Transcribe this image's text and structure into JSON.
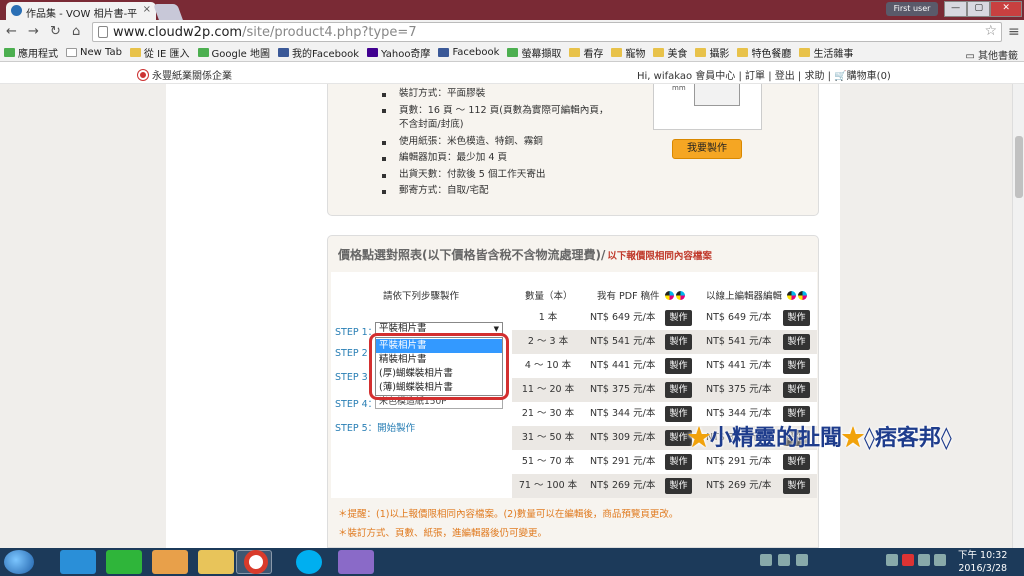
{
  "browser": {
    "tab_title": "作品集 - VOW 相片書-平",
    "tab_close": "×",
    "user_badge": "First user",
    "window_buttons": [
      "—",
      "▢",
      "✕"
    ],
    "nav_icons": [
      "back-arrow-icon",
      "forward-arrow-icon",
      "reload-icon",
      "home-icon"
    ],
    "url_domain": "www.cloudw2p.com",
    "url_path": "/site/product4.php?type=7",
    "bookmarks": [
      "應用程式",
      "New Tab",
      "從 IE 匯入",
      "Google 地圖",
      "我的Facebook",
      "Yahoo奇摩",
      "Facebook",
      "螢幕擷取",
      "看存",
      "寵物",
      "美食",
      "攝影",
      "特色餐廳",
      "生活雜事"
    ],
    "other_bookmarks": "其他書籤"
  },
  "site": {
    "company": "永豐紙業關係企業",
    "user_links": "Hi, wifakao 會員中心 | 訂單 | 登出 | 求助 |",
    "cart": "購物車(0)"
  },
  "specs": [
    "裝訂方式：平面膠裝",
    "頁數：16 頁 ～ 112 頁(頁數為實際可編輯內頁，",
    "不含封面/封底)",
    "使用紙張：米色模造、特銅、霧銅",
    "編輯器加頁：最少加 4 頁",
    "出貨天數：付款後 5 個工作天寄出",
    "郵寄方式：自取/宅配"
  ],
  "thumb_unit": "mm",
  "make_main_button": "我要製作",
  "pricing": {
    "title": "價格點選對照表(以下價格皆含稅不含物流處理費)/",
    "subtitle": "以下報價限相同內容檔案",
    "headers": {
      "steps": "請依下列步驟製作",
      "qty": "數量（本）",
      "pdf": "我有 PDF 稿件",
      "online": "以線上編輯器編輯"
    },
    "steps": [
      "STEP 1：",
      "STEP 2",
      "STEP 3",
      "STEP 4：",
      "STEP 5："
    ],
    "start_link": "開始製作",
    "select_value": "平裝相片書",
    "dropdown_options": [
      "平裝相片書",
      "精裝相片書",
      "(厚)蝴蝶裝相片書",
      "(薄)蝴蝶裝相片書"
    ],
    "behind_value": "米色模造紙150P",
    "rows": [
      {
        "qty": "1 本",
        "pdf": "NT$ 649 元/本",
        "online": "NT$ 649 元/本"
      },
      {
        "qty": "2 ～ 3 本",
        "pdf": "NT$ 541 元/本",
        "online": "NT$ 541 元/本"
      },
      {
        "qty": "4 ～ 10 本",
        "pdf": "NT$ 441 元/本",
        "online": "NT$ 441 元/本"
      },
      {
        "qty": "11 ～ 20 本",
        "pdf": "NT$ 375 元/本",
        "online": "NT$ 375 元/本"
      },
      {
        "qty": "21 ～ 30 本",
        "pdf": "NT$ 344 元/本",
        "online": "NT$ 344 元/本"
      },
      {
        "qty": "31 ～ 50 本",
        "pdf": "NT$ 309 元/本",
        "online": "NT$ 309 元/本"
      },
      {
        "qty": "51 ～ 70 本",
        "pdf": "NT$ 291 元/本",
        "online": "NT$ 291 元/本"
      },
      {
        "qty": "71 ～ 100 本",
        "pdf": "NT$ 269 元/本",
        "online": "NT$ 269 元/本"
      }
    ],
    "make_label": "製作",
    "notes": [
      "＊提醒：(1)以上報價限相同內容檔案。(2)數量可以在編輯後，商品預覽頁更改。",
      "＊裝訂方式、頁數、紙張，進編輯器後仍可變更。"
    ]
  },
  "watermark": {
    "star": "★",
    "text1": "小精靈的扯聞",
    "text2": "◊痞客邦◊"
  },
  "taskbar": {
    "time": "下午 10:32",
    "date": "2016/3/28"
  },
  "colors": {
    "accent_orange": "#f5a623",
    "link_blue": "#2a7fb5",
    "highlight_red": "#d32f2f",
    "select_blue": "#3399ff"
  }
}
